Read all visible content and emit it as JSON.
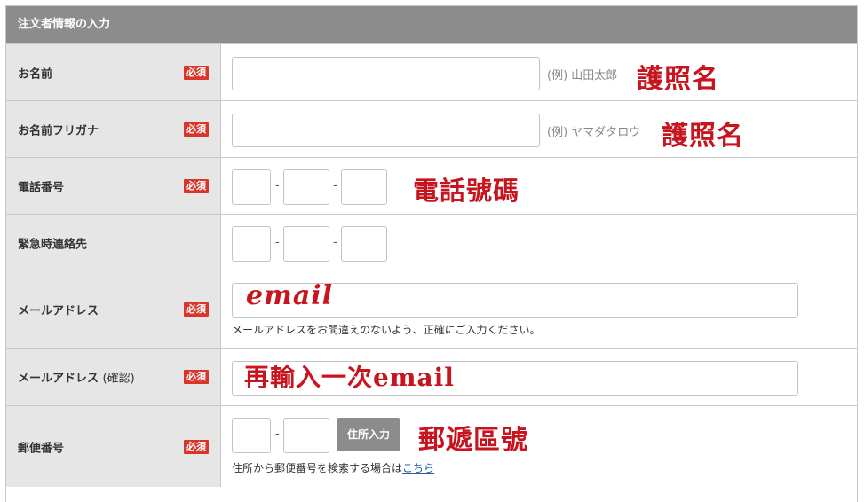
{
  "section_title": "注文者情報の入力",
  "required_label": "必須",
  "rows": {
    "name": {
      "label": "お名前",
      "example": "(例) 山田太郎",
      "annotation": "護照名"
    },
    "kana": {
      "label": "お名前フリガナ",
      "example": "(例) ヤマダタロウ",
      "annotation": "護照名"
    },
    "phone": {
      "label": "電話番号",
      "separator": "-",
      "annotation": "電話號碼"
    },
    "emergency": {
      "label": "緊急時連絡先",
      "separator": "-"
    },
    "email": {
      "label": "メールアドレス",
      "hint": "メールアドレスをお間違えのないよう、正確にご入力ください。",
      "annotation": "email"
    },
    "email_confirm": {
      "label": "メールアドレス",
      "label_sub": "(確認)",
      "annotation": "再輸入一次email"
    },
    "postal": {
      "label": "郵便番号",
      "separator": "-",
      "button": "住所入力",
      "hint_prefix": "住所から郵便番号を検索する場合は",
      "hint_link": "こちら",
      "annotation": "郵遞區號"
    }
  },
  "colors": {
    "header_bg": "#8c8c8c",
    "label_bg": "#e6e6e6",
    "required_bg": "#d9352b",
    "annotation": "#c8141e",
    "link": "#1f5fa8"
  }
}
